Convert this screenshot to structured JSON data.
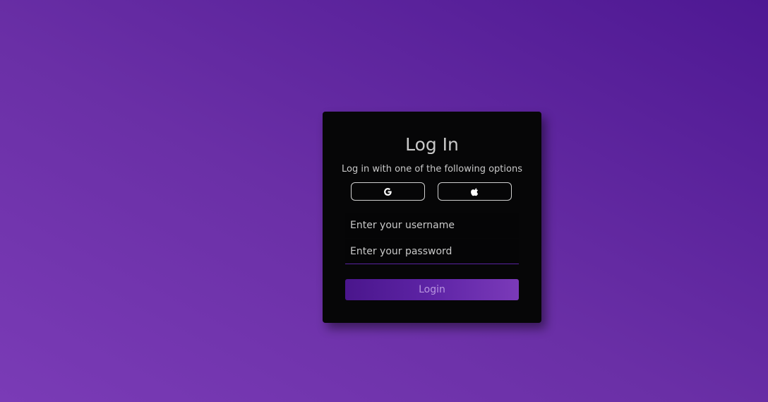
{
  "login": {
    "title": "Log In",
    "subtitle": "Log in with one of the following options",
    "social": [
      {
        "provider": "google",
        "icon": "google-icon"
      },
      {
        "provider": "apple",
        "icon": "apple-icon"
      }
    ],
    "username": {
      "value": "",
      "placeholder": "Enter your username"
    },
    "password": {
      "value": "",
      "placeholder": "Enter your password"
    },
    "submit_label": "Login"
  },
  "colors": {
    "background_start": "#7a3bb6",
    "background_end": "#4e1893",
    "card": "#060607",
    "accent": "#5a23a0",
    "text": "#c9c9c9"
  }
}
